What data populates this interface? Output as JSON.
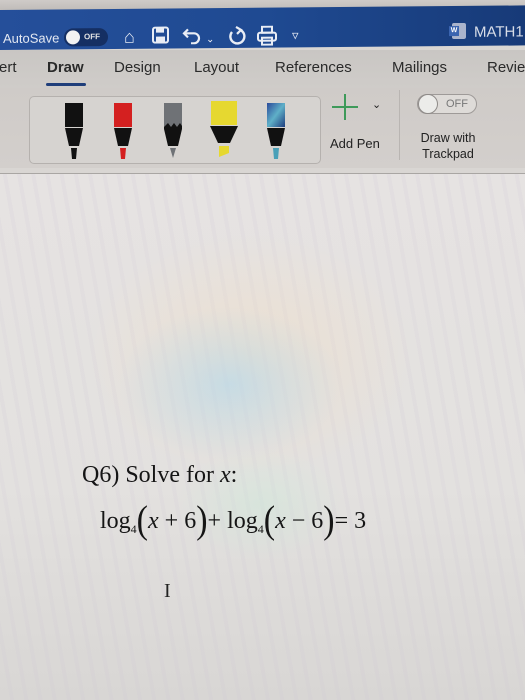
{
  "titlebar": {
    "autosave_label": "AutoSave",
    "autosave_state": "OFF",
    "quick_access": [
      "home-icon",
      "save-icon",
      "undo-icon",
      "undo-dropdown-icon",
      "redo-icon",
      "print-icon",
      "customize-toolbar-icon"
    ],
    "doc_title": "MATH1",
    "colors": {
      "bar": "#1f4a92"
    }
  },
  "tabs": {
    "items": [
      {
        "label": "ert",
        "active": false
      },
      {
        "label": "Draw",
        "active": true
      },
      {
        "label": "Design",
        "active": false
      },
      {
        "label": "Layout",
        "active": false
      },
      {
        "label": "References",
        "active": false
      },
      {
        "label": "Mailings",
        "active": false
      },
      {
        "label": "Revie",
        "active": false
      }
    ]
  },
  "ribbon": {
    "pens": [
      {
        "name": "black-pen",
        "color": "#111111"
      },
      {
        "name": "red-pen",
        "color": "#d42020"
      },
      {
        "name": "gray-pencil",
        "color": "#6f7276"
      },
      {
        "name": "yellow-highlighter",
        "color": "#e6d830"
      },
      {
        "name": "galaxy-pen",
        "color": "#3f78a8"
      }
    ],
    "add_pen_label": "Add Pen",
    "trackpad_toggle_state": "OFF",
    "trackpad_label_line1": "Draw with",
    "trackpad_label_line2": "Trackpad"
  },
  "document": {
    "question_prefix": "Q6)  Solve for ",
    "question_var": "x",
    "question_suffix": ":",
    "equation": {
      "log1": "log",
      "base1": "4",
      "arg1_var": "x",
      "arg1_rest": " + 6",
      "plus": "+ ",
      "log2": "log",
      "base2": "4",
      "arg2_var": "x",
      "arg2_rest": " − 6",
      "rhs": "= 3"
    },
    "cursor": "I"
  }
}
